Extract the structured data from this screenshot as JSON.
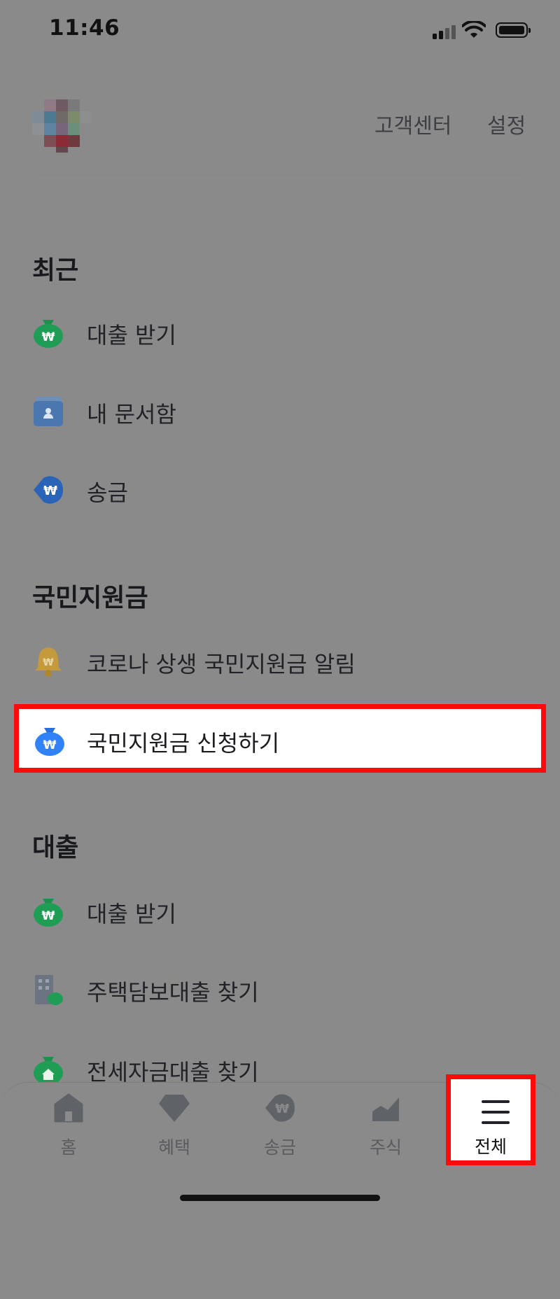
{
  "status": {
    "time": "11:46"
  },
  "header": {
    "customer_center": "고객센터",
    "settings": "설정"
  },
  "sections": [
    {
      "title": "최근",
      "items": [
        {
          "label": "대출 받기",
          "icon": "green-money-bag-icon"
        },
        {
          "label": "내 문서함",
          "icon": "document-box-icon"
        },
        {
          "label": "송금",
          "icon": "transfer-won-icon"
        }
      ]
    },
    {
      "title": "국민지원금",
      "items": [
        {
          "label": "코로나 상생 국민지원금 알림",
          "icon": "bell-icon"
        },
        {
          "label": "국민지원금 신청하기",
          "icon": "blue-money-bag-icon"
        }
      ]
    },
    {
      "title": "대출",
      "items": [
        {
          "label": "대출 받기",
          "icon": "green-money-bag-icon"
        },
        {
          "label": "주택담보대출 찾기",
          "icon": "building-money-icon"
        },
        {
          "label": "전세자금대출 찾기",
          "icon": "house-money-icon"
        }
      ]
    }
  ],
  "nav": {
    "items": [
      {
        "label": "홈",
        "icon": "home-icon"
      },
      {
        "label": "혜택",
        "icon": "gem-icon"
      },
      {
        "label": "송금",
        "icon": "transfer-won-icon"
      },
      {
        "label": "주식",
        "icon": "stock-chart-icon"
      },
      {
        "label": "전체",
        "icon": "menu-icon"
      }
    ]
  },
  "colors": {
    "highlight": "#ff0a0a",
    "dim_overlay": "#8a8a8a",
    "green": "#1f9d55",
    "blue": "#3182f6"
  }
}
